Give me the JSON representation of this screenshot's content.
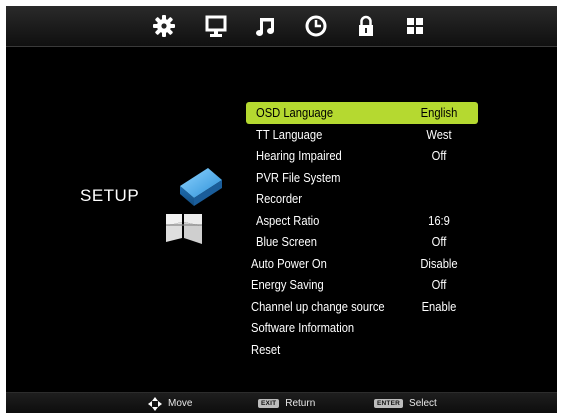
{
  "tabs": [
    {
      "icon": "gear-icon",
      "active": true
    },
    {
      "icon": "monitor-icon",
      "active": false
    },
    {
      "icon": "music-note-icon",
      "active": false
    },
    {
      "icon": "clock-icon",
      "active": false
    },
    {
      "icon": "lock-icon",
      "active": false
    },
    {
      "icon": "grid-icon",
      "active": false
    }
  ],
  "section": {
    "title": "SETUP"
  },
  "menu": {
    "items": [
      {
        "label": "OSD Language",
        "value": "English"
      },
      {
        "label": "TT Language",
        "value": "West"
      },
      {
        "label": "Hearing Impaired",
        "value": "Off"
      },
      {
        "label": "PVR File System",
        "value": ""
      },
      {
        "label": "Recorder",
        "value": ""
      },
      {
        "label": "Aspect Ratio",
        "value": "16:9"
      },
      {
        "label": "Blue Screen",
        "value": "Off"
      },
      {
        "label": "Auto Power On",
        "value": "Disable"
      },
      {
        "label": "Energy Saving",
        "value": "Off"
      },
      {
        "label": "Channel up change source",
        "value": "Enable"
      },
      {
        "label": "Software Information",
        "value": ""
      },
      {
        "label": "Reset",
        "value": ""
      }
    ]
  },
  "footer": {
    "move_label": "Move",
    "exit_key": "EXIT",
    "return_label": "Return",
    "enter_key": "ENTER",
    "select_label": "Select"
  },
  "colors": {
    "highlight": "#b5d930",
    "background": "#000000",
    "tile_blue": "#35a6e6"
  }
}
